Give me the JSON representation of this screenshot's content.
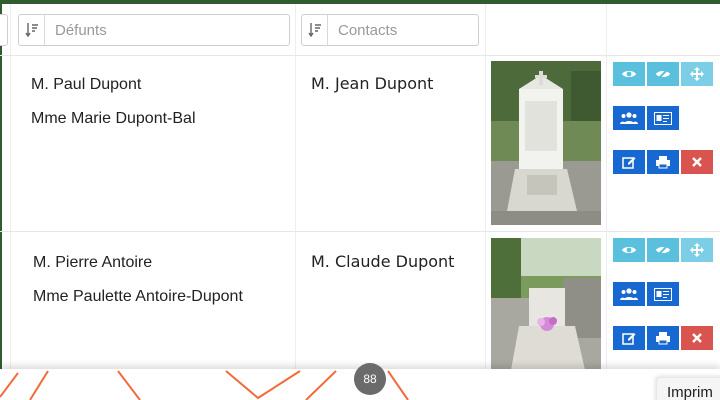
{
  "filters": {
    "defunts_placeholder": "Défunts",
    "contacts_placeholder": "Contacts"
  },
  "rows": [
    {
      "defunts": [
        "M. Paul Dupont",
        "Mme Marie Dupont-Bal"
      ],
      "contact": "M. Jean Dupont",
      "photo": "grave-photo-white-tomb"
    },
    {
      "defunts": [
        "M. Pierre Antoire",
        "Mme Paulette Antoire-Dupont"
      ],
      "contact": "M. Claude Dupont",
      "photo": "grave-photo-grey-tomb-flowers"
    }
  ],
  "footer": {
    "badge_count": "88",
    "print_label": "Imprim"
  },
  "colors": {
    "view_button": "#5bc0de",
    "action_button": "#1769d1",
    "delete_button": "#d9534f",
    "frame_border": "#2f5d2f"
  }
}
